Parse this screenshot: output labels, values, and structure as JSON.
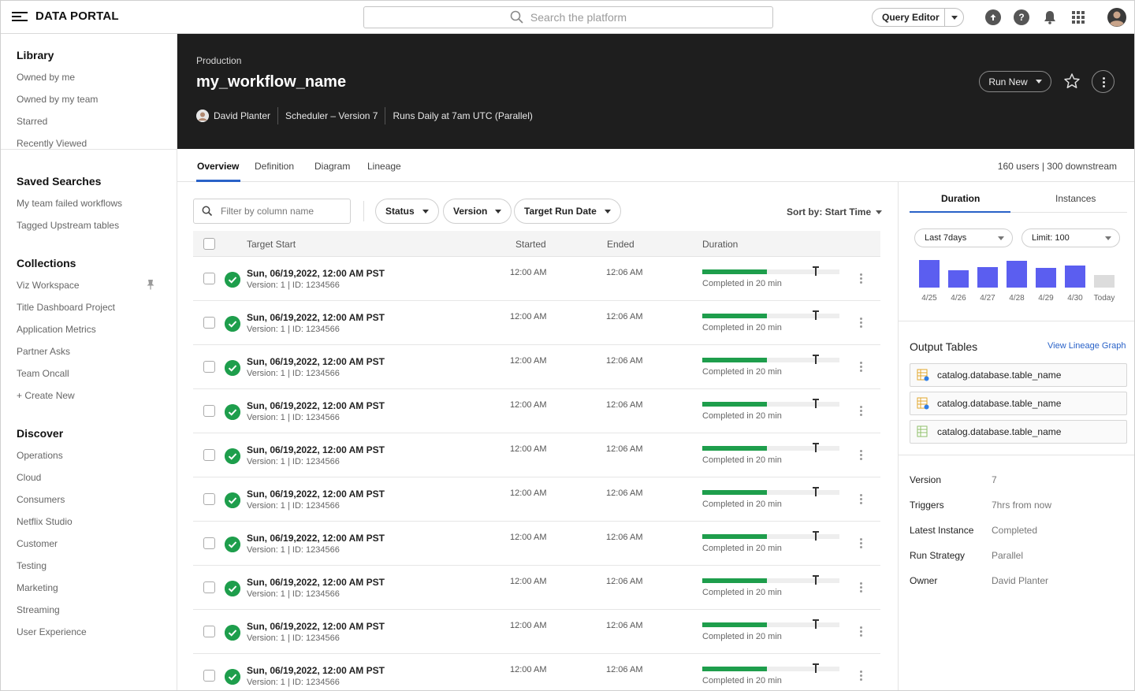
{
  "app": {
    "title": "DATA PORTAL"
  },
  "search": {
    "placeholder": "Search the platform"
  },
  "toolbar": {
    "query_editor_label": "Query Editor",
    "help_label": "?"
  },
  "sidebar": {
    "library": {
      "title": "Library",
      "items": [
        "Owned by me",
        "Owned by my team",
        "Starred",
        "Recently Viewed"
      ]
    },
    "saved": {
      "title": "Saved Searches",
      "items": [
        "My team failed workflows",
        "Tagged Upstream tables"
      ]
    },
    "collections": {
      "title": "Collections",
      "items": [
        "Viz Workspace",
        "Title Dashboard Project",
        "Application Metrics",
        "Partner Asks",
        "Team Oncall",
        "+ Create New"
      ]
    },
    "discover": {
      "title": "Discover",
      "items": [
        "Operations",
        "Cloud",
        "Consumers",
        "Netflix Studio",
        "Customer",
        "Testing",
        "Marketing",
        "Streaming",
        "User Experience"
      ]
    }
  },
  "header": {
    "environment": "Production",
    "workflow_name": "my_workflow_name",
    "owner": "David Planter",
    "scheduler": "Scheduler – Version 7",
    "schedule": "Runs Daily at 7am UTC (Parallel)",
    "run_new_label": "Run New"
  },
  "tabs": {
    "items": [
      "Overview",
      "Definition",
      "Diagram",
      "Lineage"
    ],
    "active": "Overview",
    "stats": "160 users | 300 downstream"
  },
  "filters": {
    "column_placeholder": "Filter by column name",
    "status_label": "Status",
    "version_label": "Version",
    "target_run_date_label": "Target Run Date",
    "sort_label": "Sort by: Start Time"
  },
  "table": {
    "columns": {
      "target_start": "Target Start",
      "started": "Started",
      "ended": "Ended",
      "duration": "Duration"
    },
    "rows": [
      {
        "target_start": "Sun, 06/19,2022, 12:00 AM PST",
        "meta": "Version: 1 | ID: 1234566",
        "started": "12:00 AM",
        "ended": "12:06 AM",
        "duration_label": "Completed in 20 min",
        "progress": 0.47
      },
      {
        "target_start": "Sun, 06/19,2022, 12:00 AM PST",
        "meta": "Version: 1 | ID: 1234566",
        "started": "12:00 AM",
        "ended": "12:06 AM",
        "duration_label": "Completed in 20 min",
        "progress": 0.47
      },
      {
        "target_start": "Sun, 06/19,2022, 12:00 AM PST",
        "meta": "Version: 1 | ID: 1234566",
        "started": "12:00 AM",
        "ended": "12:06 AM",
        "duration_label": "Completed in 20 min",
        "progress": 0.47
      },
      {
        "target_start": "Sun, 06/19,2022, 12:00 AM PST",
        "meta": "Version: 1 | ID: 1234566",
        "started": "12:00 AM",
        "ended": "12:06 AM",
        "duration_label": "Completed in 20 min",
        "progress": 0.47
      },
      {
        "target_start": "Sun, 06/19,2022, 12:00 AM PST",
        "meta": "Version: 1 | ID: 1234566",
        "started": "12:00 AM",
        "ended": "12:06 AM",
        "duration_label": "Completed in 20 min",
        "progress": 0.47
      },
      {
        "target_start": "Sun, 06/19,2022, 12:00 AM PST",
        "meta": "Version: 1 | ID: 1234566",
        "started": "12:00 AM",
        "ended": "12:06 AM",
        "duration_label": "Completed in 20 min",
        "progress": 0.47
      },
      {
        "target_start": "Sun, 06/19,2022, 12:00 AM PST",
        "meta": "Version: 1 | ID: 1234566",
        "started": "12:00 AM",
        "ended": "12:06 AM",
        "duration_label": "Completed in 20 min",
        "progress": 0.47
      },
      {
        "target_start": "Sun, 06/19,2022, 12:00 AM PST",
        "meta": "Version: 1 | ID: 1234566",
        "started": "12:00 AM",
        "ended": "12:06 AM",
        "duration_label": "Completed in 20 min",
        "progress": 0.47
      },
      {
        "target_start": "Sun, 06/19,2022, 12:00 AM PST",
        "meta": "Version: 1 | ID: 1234566",
        "started": "12:00 AM",
        "ended": "12:06 AM",
        "duration_label": "Completed in 20 min",
        "progress": 0.47
      },
      {
        "target_start": "Sun, 06/19,2022, 12:00 AM PST",
        "meta": "Version: 1 | ID: 1234566",
        "started": "12:00 AM",
        "ended": "12:06 AM",
        "duration_label": "Completed in 20 min",
        "progress": 0.47
      }
    ]
  },
  "right_panel": {
    "tabs": [
      "Duration",
      "Instances"
    ],
    "active_tab": "Duration",
    "range_label": "Last 7days",
    "limit_label": "Limit: 100",
    "duration_chart": {
      "categories": [
        "4/25",
        "4/26",
        "4/27",
        "4/28",
        "4/29",
        "4/30",
        "Today"
      ],
      "values": [
        35,
        22,
        26,
        34,
        25,
        28,
        16
      ],
      "max": 36
    },
    "output_title": "Output Tables",
    "lineage_link": "View Lineage Graph",
    "output_tables": [
      "catalog.database.table_name",
      "catalog.database.table_name",
      "catalog.database.table_name"
    ],
    "details": [
      {
        "key": "Version",
        "value": "7"
      },
      {
        "key": "Triggers",
        "value": "7hrs from now"
      },
      {
        "key": "Latest Instance",
        "value": "Completed"
      },
      {
        "key": "Run Strategy",
        "value": "Parallel"
      },
      {
        "key": "Owner",
        "value": "David Planter"
      }
    ]
  },
  "colors": {
    "accent": "#2962c8",
    "success": "#1e9e4c",
    "bar_active": "#5b5ef0",
    "bar_today": "#dcdcdc",
    "header_bg": "#1e1e1e"
  }
}
